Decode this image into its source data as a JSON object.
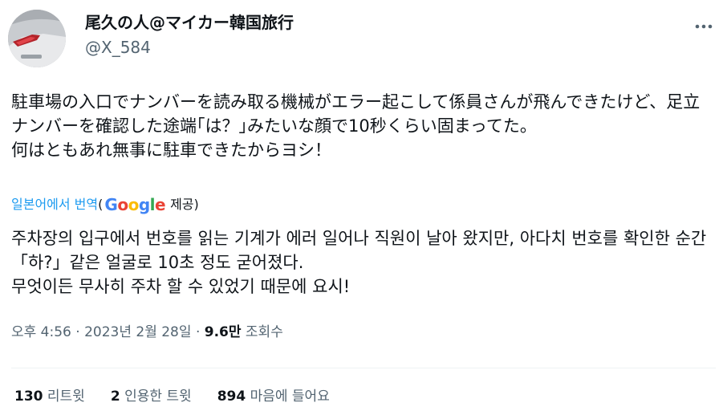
{
  "author": {
    "display_name": "尾久の人@マイカー韓国旅行",
    "handle": "@X_584"
  },
  "tweet": {
    "text": "駐車場の入口でナンバーを読み取る機械がエラー起こして係員さんが飛んできたけど、足立ナンバーを確認した途端｢は？｣みたいな顔で10秒くらい固まってた。\n何はともあれ無事に駐車できたからヨシ！"
  },
  "translation": {
    "link_label": "일본어에서 번역",
    "open_paren": "(",
    "google_g1": "G",
    "google_o1": "o",
    "google_o2": "o",
    "google_g2": "g",
    "google_l": "l",
    "google_e": "e",
    "provider_suffix": "제공)",
    "text": "주차장의 입구에서 번호를 읽는 기계가 에러 일어나 직원이 날아 왔지만, 아다치 번호를 확인한 순간「하?」같은 얼굴로 10초 정도 굳어졌다.\n무엇이든 무사히 주차 할 수 있었기 때문에 요시!"
  },
  "meta": {
    "time": "오후 4:56",
    "separator1": "·",
    "date": "2023년 2월 28일",
    "separator2": "·",
    "views_count": "9.6만",
    "views_label": "조회수"
  },
  "stats": {
    "retweets_count": "130",
    "retweets_label": "리트윗",
    "quotes_count": "2",
    "quotes_label": "인용한 트윗",
    "likes_count": "894",
    "likes_label": "마음에 들어요"
  },
  "colors": {
    "link": "#1d9bf0",
    "secondary_text": "#536471",
    "primary_text": "#0f1419"
  },
  "icons": {
    "more": "more-horizontal-icon",
    "avatar": "car-photo"
  }
}
